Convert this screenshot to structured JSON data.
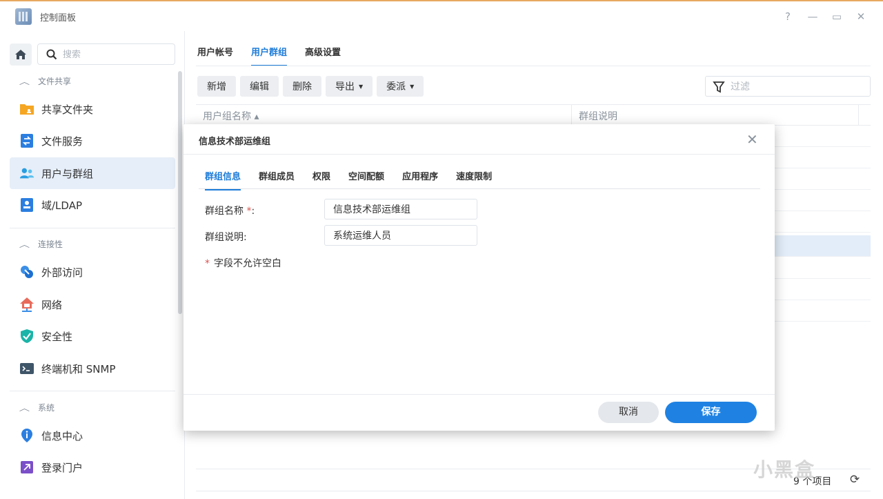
{
  "window": {
    "title": "控制面板",
    "controls": [
      "?",
      "—",
      "▭",
      "✕"
    ]
  },
  "sidebar": {
    "search_placeholder": "搜索",
    "sections": [
      {
        "label": "文件共享"
      },
      {
        "label": "连接性"
      },
      {
        "label": "系统"
      }
    ],
    "items": [
      {
        "label": "共享文件夹",
        "icon": "shared-folder-icon"
      },
      {
        "label": "文件服务",
        "icon": "file-services-icon"
      },
      {
        "label": "用户与群组",
        "icon": "users-groups-icon",
        "active": true
      },
      {
        "label": "域/LDAP",
        "icon": "domain-ldap-icon"
      },
      {
        "label": "外部访问",
        "icon": "external-access-icon"
      },
      {
        "label": "网络",
        "icon": "network-icon"
      },
      {
        "label": "安全性",
        "icon": "security-shield-icon"
      },
      {
        "label": "终端机和 SNMP",
        "icon": "terminal-icon"
      },
      {
        "label": "信息中心",
        "icon": "info-center-icon"
      },
      {
        "label": "登录门户",
        "icon": "login-portal-icon"
      }
    ]
  },
  "main": {
    "tabs": [
      {
        "label": "用户帐号"
      },
      {
        "label": "用户群组",
        "active": true
      },
      {
        "label": "高级设置"
      }
    ],
    "toolbar": {
      "add": "新增",
      "edit": "编辑",
      "delete": "删除",
      "export": "导出",
      "delegate": "委派"
    },
    "filter_placeholder": "过滤",
    "grid": {
      "columns": [
        "用户组名称 ▴",
        "群组说明"
      ]
    },
    "item_count": "9 个项目"
  },
  "dialog": {
    "title": "信息技术部运维组",
    "tabs": [
      {
        "label": "群组信息",
        "active": true
      },
      {
        "label": "群组成员"
      },
      {
        "label": "权限"
      },
      {
        "label": "空间配额"
      },
      {
        "label": "应用程序"
      },
      {
        "label": "速度限制"
      }
    ],
    "fields": {
      "name_label": "群组名称",
      "name_value": "信息技术部运维组",
      "desc_label": "群组说明:",
      "desc_value": "系统运维人员"
    },
    "note": "字段不允许空白",
    "cancel": "取消",
    "save": "保存"
  },
  "watermark": "小黑盒",
  "colors": {
    "accent": "#1d7bd8",
    "save_button": "#1f82e3",
    "selected_row": "#e3edf9",
    "required": "#d9534f"
  }
}
